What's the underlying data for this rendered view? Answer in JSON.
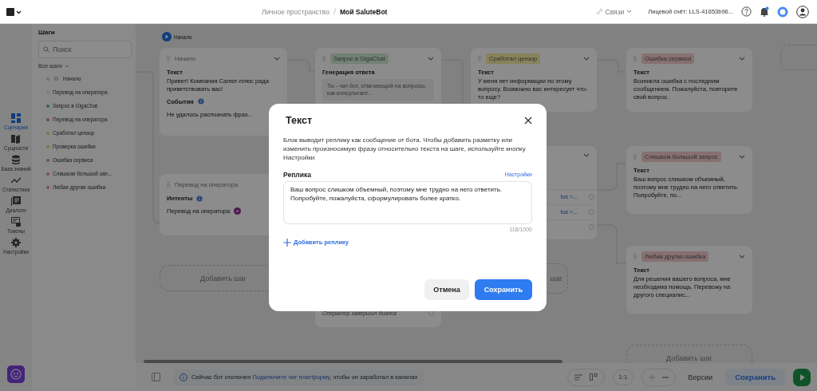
{
  "header": {
    "breadcrumb": [
      {
        "label": "Личное пространство",
        "current": false
      },
      {
        "label": "Мой SaluteBot",
        "current": true
      }
    ],
    "links_menu": "Связи",
    "account": "Лицевой счёт: LLS-41653b96..."
  },
  "rail": [
    {
      "label": "Сценарии",
      "selected": true
    },
    {
      "label": "Сущности",
      "selected": false
    },
    {
      "label": "База знаний",
      "selected": false
    },
    {
      "label": "Статистика",
      "selected": false
    },
    {
      "label": "Диалоги",
      "selected": false
    },
    {
      "label": "Токены",
      "selected": false
    },
    {
      "label": "Настройки",
      "selected": false
    }
  ],
  "sidebar": {
    "title": "Шаги",
    "search_placeholder": "Поиск",
    "filter": "Все шаги",
    "steps": [
      {
        "label": "Начало",
        "color": "#727272",
        "start": true
      },
      {
        "label": "Перевод на оператора",
        "color": "#7b7b7b",
        "start": false
      },
      {
        "label": "Запрос в GigaChat",
        "color": "#336546",
        "start": false
      },
      {
        "label": "Перевод на оператора",
        "color": "#7c4444",
        "start": false
      },
      {
        "label": "Сработал цензор",
        "color": "#7f753a",
        "start": false
      },
      {
        "label": "Проверка ошибки",
        "color": "#7f753a",
        "start": false
      },
      {
        "label": "Ошибка сервиса",
        "color": "#7b4f4f",
        "start": false
      },
      {
        "label": "Слишком большой зап...",
        "color": "#7b4f4f",
        "start": false
      },
      {
        "label": "Любая другая ошибка",
        "color": "#7b4f4f",
        "start": false
      }
    ]
  },
  "canvas": {
    "start_label": "Начало",
    "nodes": [
      {
        "kind": "plain",
        "title": "Начало",
        "sections": [
          {
            "kind": "text",
            "heading": "Текст",
            "body": "Привет! Компания Салют-плюс рада приветствовать вас!"
          },
          {
            "kind": "events",
            "heading": "События",
            "body": "Не удалось распознать фраз..."
          }
        ]
      },
      {
        "kind": "tag",
        "title": "Запрос в GigaChat",
        "color": "#718175",
        "sections": [
          {
            "kind": "generation",
            "heading": "Генерация ответа",
            "body": "Ты - чат-бот, отвечающий на вопросы, как консультант..."
          },
          {
            "kind": "note",
            "body": "Оператор завершил диалог"
          }
        ]
      },
      {
        "kind": "tag",
        "title": "Сработал цензор",
        "color": "#88825b",
        "sections": [
          {
            "kind": "text",
            "heading": "Текст",
            "body": "У меня нет информации по этому вопросу. Возможно вас интересует что-то еще?"
          }
        ]
      },
      {
        "kind": "hidden",
        "sections": [
          {
            "kind": "condition",
            "body": "tus =..."
          },
          {
            "kind": "condition",
            "body": "tus =..."
          }
        ]
      },
      {
        "kind": "tag",
        "title": "Ошибка сервиса",
        "color": "#877070",
        "sections": [
          {
            "kind": "text",
            "heading": "Текст",
            "body": "Возникла ошибка с последним сообщением. Пожалуйста, повторите свой вопрос."
          }
        ]
      },
      {
        "kind": "tag",
        "title": "Слишком большой запрос",
        "color": "#877070",
        "sections": [
          {
            "kind": "text",
            "heading": "Текст",
            "body": "Ваш вопрос слишком объемный, поэтому мне трудно на него ответить. Попробуйте, по..."
          }
        ]
      },
      {
        "kind": "tag",
        "title": "Любая другая ошибка",
        "color": "#877070",
        "sections": [
          {
            "kind": "text",
            "heading": "Текст",
            "body": "Для решения вашего вопроса, мне необходима помощь. Перевожу на другого специалис..."
          }
        ]
      },
      {
        "kind": "plain",
        "title": "Перевод на оператора",
        "sections": [
          {
            "kind": "intents",
            "heading": "Интенты",
            "body": "Перевод на оператора"
          }
        ]
      }
    ],
    "add_step_buttons": [
      "Добавить шаг",
      "шаг",
      "Добавить шаг"
    ]
  },
  "bottom_bar": {
    "notice": {
      "text": "Сейчас бот отключен",
      "link": "Подключите чат платформу",
      "rest": ", чтобы он заработал в каналах"
    },
    "zoom": "1:1",
    "versions": "Версии",
    "save": "Сохранить"
  },
  "modal": {
    "title": "Текст",
    "description": "Блок выводит реплику как сообщение от бота. Чтобы добавить разметку или изменить произносимую фразу относительно текста на шаге, используйте кнопку Настройки",
    "field_label": "Реплика",
    "settings_link": "Настройки",
    "value": "Ваш вопрос слишком объемный, поэтому мне трудно на него ответить. Попробуйте, пожалуйста, сформулировать более кратко.",
    "counter": "118/1000",
    "add_reply": "Добавить реплику",
    "cancel": "Отмена",
    "save": "Сохранить"
  }
}
